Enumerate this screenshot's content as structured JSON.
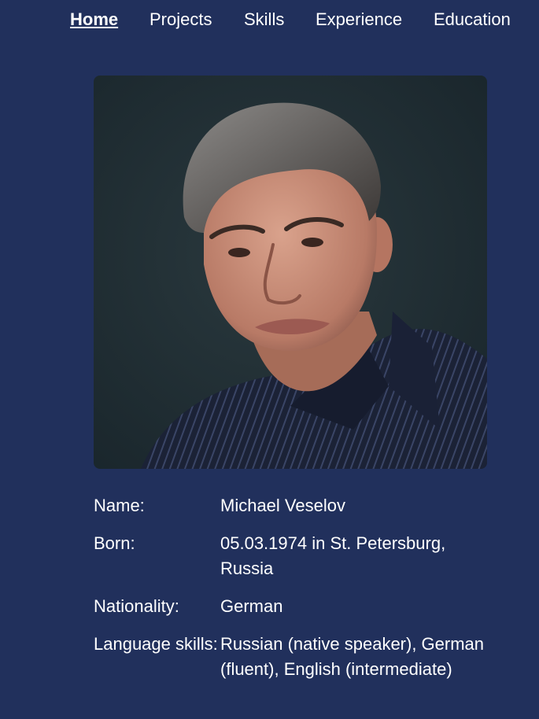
{
  "nav": {
    "items": [
      {
        "label": "Home",
        "active": true
      },
      {
        "label": "Projects",
        "active": false
      },
      {
        "label": "Skills",
        "active": false
      },
      {
        "label": "Experience",
        "active": false
      },
      {
        "label": "Education",
        "active": false
      }
    ]
  },
  "profile": {
    "photo": "portrait-photo",
    "rows": [
      {
        "label": "Name:",
        "value": "Michael Veselov"
      },
      {
        "label": "Born:",
        "value": "05.03.1974 in St. Petersburg, Russia"
      },
      {
        "label": "Nationality:",
        "value": "German"
      },
      {
        "label": "Language skills:",
        "value": "Russian (native speaker), German (fluent), English (intermediate)"
      }
    ]
  },
  "colors": {
    "background": "#21305c",
    "text": "#ffffff",
    "photo_background": "#1f2c30"
  }
}
